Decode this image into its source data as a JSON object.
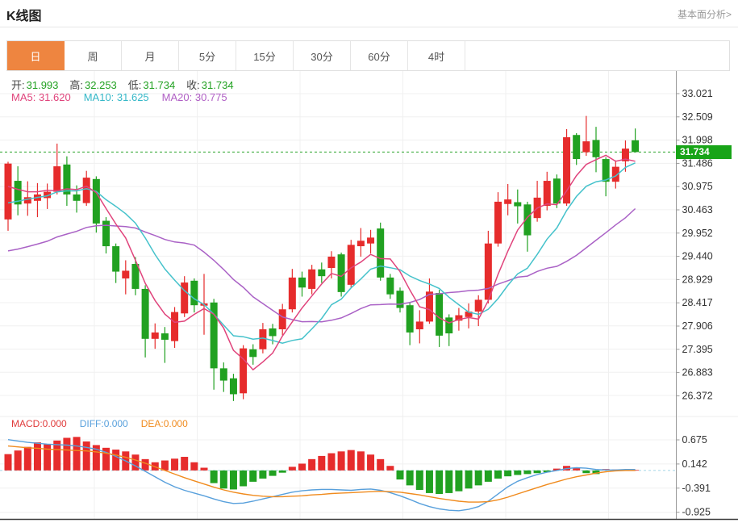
{
  "header": {
    "title": "K线图",
    "analysis_link": "基本面分析>"
  },
  "tabs": {
    "items": [
      "日",
      "周",
      "月",
      "5分",
      "15分",
      "30分",
      "60分",
      "4时"
    ],
    "active_index": 0
  },
  "ohlc": {
    "open_label": "开:",
    "open": "31.993",
    "high_label": "高:",
    "high": "32.253",
    "low_label": "低:",
    "low": "31.734",
    "close_label": "收:",
    "close": "31.734"
  },
  "ma_legend": {
    "ma5": "MA5: 31.620",
    "ma10": "MA10: 31.625",
    "ma20": "MA20: 30.775"
  },
  "macd_legend": {
    "macd": "MACD:0.000",
    "diff": "DIFF:0.000",
    "dea": "DEA:0.000"
  },
  "current_price_badge": "31.734",
  "colors": {
    "up_red": "#e62c2c",
    "down_green": "#21a121",
    "badge_green": "#18a418",
    "ma5_pink": "#e0447c",
    "ma10_cyan": "#45c2cb",
    "ma20_purple": "#aa62c6",
    "diff_blue": "#58a0dc",
    "dea_orange": "#f08b1e",
    "active_tab_orange": "#ee8540",
    "grid": "#f0f0f0",
    "axis": "#999999",
    "axis_text": "#333333",
    "zero_dotted": "#a5d5e8",
    "price_dotted": "#2aa32a",
    "bottom_frame": "#3c3c3c"
  },
  "chart_data": {
    "type": "candlestick+macd",
    "main": {
      "y_axis_labels": [
        "33.021",
        "32.509",
        "31.998",
        "31.486",
        "30.975",
        "30.463",
        "29.952",
        "29.440",
        "28.929",
        "28.417",
        "27.906",
        "27.395",
        "26.883",
        "26.372"
      ],
      "current_price": 31.734,
      "candles_format": [
        "open",
        "close",
        "high",
        "low"
      ],
      "candles": [
        [
          30.25,
          31.48,
          31.52,
          30.0
        ],
        [
          31.1,
          30.58,
          31.42,
          30.34
        ],
        [
          30.6,
          30.74,
          31.09,
          30.33
        ],
        [
          30.66,
          30.8,
          31.05,
          30.3
        ],
        [
          30.72,
          30.86,
          31.04,
          30.48
        ],
        [
          30.86,
          31.42,
          31.92,
          30.8
        ],
        [
          31.46,
          30.8,
          31.64,
          30.55
        ],
        [
          30.8,
          30.66,
          31.0,
          30.4
        ],
        [
          30.61,
          31.17,
          31.32,
          30.55
        ],
        [
          31.14,
          30.16,
          31.2,
          29.96
        ],
        [
          30.22,
          29.66,
          30.3,
          29.5
        ],
        [
          29.66,
          29.1,
          29.72,
          28.85
        ],
        [
          28.95,
          29.12,
          29.35,
          28.6
        ],
        [
          29.27,
          28.72,
          29.42,
          28.58
        ],
        [
          28.72,
          27.62,
          28.8,
          27.21
        ],
        [
          27.62,
          27.76,
          27.96,
          27.4
        ],
        [
          27.74,
          27.6,
          27.88,
          27.09
        ],
        [
          27.57,
          28.21,
          28.32,
          27.42
        ],
        [
          28.18,
          28.86,
          29.0,
          28.1
        ],
        [
          28.9,
          28.36,
          28.95,
          28.2
        ],
        [
          28.35,
          28.4,
          29.05,
          27.71
        ],
        [
          28.42,
          26.97,
          28.5,
          26.5
        ],
        [
          26.97,
          26.7,
          27.1,
          26.45
        ],
        [
          26.75,
          26.4,
          26.85,
          26.25
        ],
        [
          26.42,
          27.41,
          27.48,
          26.29
        ],
        [
          27.39,
          27.22,
          27.5,
          27.05
        ],
        [
          27.39,
          27.83,
          27.97,
          27.3
        ],
        [
          27.85,
          27.68,
          27.95,
          27.5
        ],
        [
          27.83,
          28.27,
          28.39,
          27.7
        ],
        [
          28.27,
          28.97,
          29.16,
          28.2
        ],
        [
          28.97,
          28.75,
          29.1,
          28.55
        ],
        [
          28.72,
          29.15,
          29.25,
          28.6
        ],
        [
          29.15,
          29.0,
          29.3,
          28.85
        ],
        [
          29.18,
          29.43,
          29.55,
          28.95
        ],
        [
          29.48,
          28.65,
          29.52,
          28.55
        ],
        [
          28.81,
          29.69,
          29.8,
          28.75
        ],
        [
          29.66,
          29.78,
          30.06,
          29.43
        ],
        [
          29.72,
          29.85,
          30.02,
          29.5
        ],
        [
          30.05,
          28.97,
          30.18,
          28.9
        ],
        [
          28.97,
          28.6,
          29.05,
          28.5
        ],
        [
          28.68,
          28.3,
          28.75,
          28.2
        ],
        [
          28.36,
          27.76,
          28.42,
          27.48
        ],
        [
          27.83,
          28.0,
          28.25,
          27.52
        ],
        [
          28.0,
          28.66,
          28.95,
          27.95
        ],
        [
          28.63,
          27.69,
          28.7,
          27.44
        ],
        [
          28.09,
          27.74,
          28.16,
          27.46
        ],
        [
          28.02,
          28.14,
          28.3,
          27.8
        ],
        [
          28.1,
          28.22,
          28.4,
          27.85
        ],
        [
          28.22,
          28.48,
          28.58,
          27.9
        ],
        [
          28.48,
          29.72,
          30.0,
          28.4
        ],
        [
          29.72,
          30.64,
          30.85,
          29.65
        ],
        [
          30.59,
          30.69,
          31.03,
          30.34
        ],
        [
          30.63,
          30.54,
          30.91,
          30.16
        ],
        [
          30.58,
          29.9,
          30.64,
          29.54
        ],
        [
          30.28,
          30.73,
          31.1,
          30.2
        ],
        [
          30.55,
          31.1,
          31.3,
          30.45
        ],
        [
          31.15,
          30.6,
          31.24,
          30.5
        ],
        [
          30.6,
          32.06,
          32.24,
          30.55
        ],
        [
          32.11,
          31.58,
          32.15,
          31.45
        ],
        [
          31.73,
          31.97,
          32.53,
          31.65
        ],
        [
          32.0,
          31.62,
          32.29,
          31.29
        ],
        [
          31.58,
          31.08,
          31.62,
          30.76
        ],
        [
          31.08,
          31.41,
          31.55,
          30.93
        ],
        [
          31.53,
          31.81,
          31.99,
          31.3
        ],
        [
          31.993,
          31.734,
          32.253,
          31.734
        ]
      ],
      "ma5_prehistory": [
        30.9,
        31.0,
        30.8,
        30.7
      ],
      "ma10_prehistory": [
        30.2,
        30.3,
        30.4,
        30.5,
        30.55,
        30.6,
        30.65,
        30.7,
        30.75
      ],
      "ma20_prehistory": [
        29.75,
        29.7,
        29.65,
        29.6,
        29.55,
        29.5,
        29.48,
        29.46,
        29.44,
        29.42,
        29.4,
        29.38,
        29.36,
        29.35,
        29.34,
        29.33,
        29.32,
        29.31,
        29.3
      ]
    },
    "macd": {
      "y_axis_labels": [
        "0.675",
        "0.142",
        "-0.391",
        "-0.925"
      ],
      "histogram": [
        0.36,
        0.44,
        0.52,
        0.62,
        0.58,
        0.66,
        0.72,
        0.74,
        0.64,
        0.56,
        0.5,
        0.46,
        0.42,
        0.35,
        0.25,
        0.18,
        0.22,
        0.26,
        0.3,
        0.18,
        0.06,
        -0.28,
        -0.4,
        -0.42,
        -0.35,
        -0.25,
        -0.18,
        -0.12,
        -0.05,
        0.08,
        0.15,
        0.25,
        0.32,
        0.38,
        0.42,
        0.45,
        0.42,
        0.35,
        0.25,
        0.1,
        -0.2,
        -0.33,
        -0.43,
        -0.5,
        -0.52,
        -0.5,
        -0.46,
        -0.4,
        -0.33,
        -0.25,
        -0.18,
        -0.13,
        -0.1,
        -0.08,
        -0.06,
        -0.04,
        0.04,
        0.1,
        0.05,
        -0.06,
        -0.08,
        0.03,
        0.02,
        0.01,
        0.01
      ],
      "diff": [
        0.68,
        0.65,
        0.62,
        0.6,
        0.58,
        0.57,
        0.56,
        0.54,
        0.51,
        0.47,
        0.4,
        0.31,
        0.21,
        0.1,
        -0.02,
        -0.14,
        -0.26,
        -0.36,
        -0.44,
        -0.5,
        -0.56,
        -0.63,
        -0.69,
        -0.73,
        -0.72,
        -0.68,
        -0.63,
        -0.58,
        -0.53,
        -0.48,
        -0.45,
        -0.43,
        -0.42,
        -0.42,
        -0.43,
        -0.44,
        -0.42,
        -0.41,
        -0.44,
        -0.49,
        -0.56,
        -0.64,
        -0.73,
        -0.8,
        -0.85,
        -0.88,
        -0.89,
        -0.86,
        -0.8,
        -0.68,
        -0.52,
        -0.36,
        -0.24,
        -0.16,
        -0.09,
        -0.04,
        0.0,
        0.04,
        0.06,
        0.05,
        0.02,
        0.01,
        0.01,
        0.02,
        0.02
      ],
      "dea": [
        0.54,
        0.52,
        0.5,
        0.49,
        0.47,
        0.46,
        0.45,
        0.44,
        0.43,
        0.41,
        0.38,
        0.34,
        0.29,
        0.23,
        0.16,
        0.08,
        0.0,
        -0.08,
        -0.16,
        -0.23,
        -0.3,
        -0.37,
        -0.43,
        -0.48,
        -0.52,
        -0.55,
        -0.57,
        -0.58,
        -0.58,
        -0.57,
        -0.56,
        -0.54,
        -0.53,
        -0.51,
        -0.5,
        -0.49,
        -0.48,
        -0.47,
        -0.46,
        -0.47,
        -0.48,
        -0.51,
        -0.54,
        -0.58,
        -0.62,
        -0.65,
        -0.68,
        -0.7,
        -0.7,
        -0.69,
        -0.65,
        -0.59,
        -0.52,
        -0.45,
        -0.38,
        -0.31,
        -0.25,
        -0.19,
        -0.14,
        -0.1,
        -0.06,
        -0.03,
        -0.01,
        0.0,
        0.0
      ]
    }
  }
}
